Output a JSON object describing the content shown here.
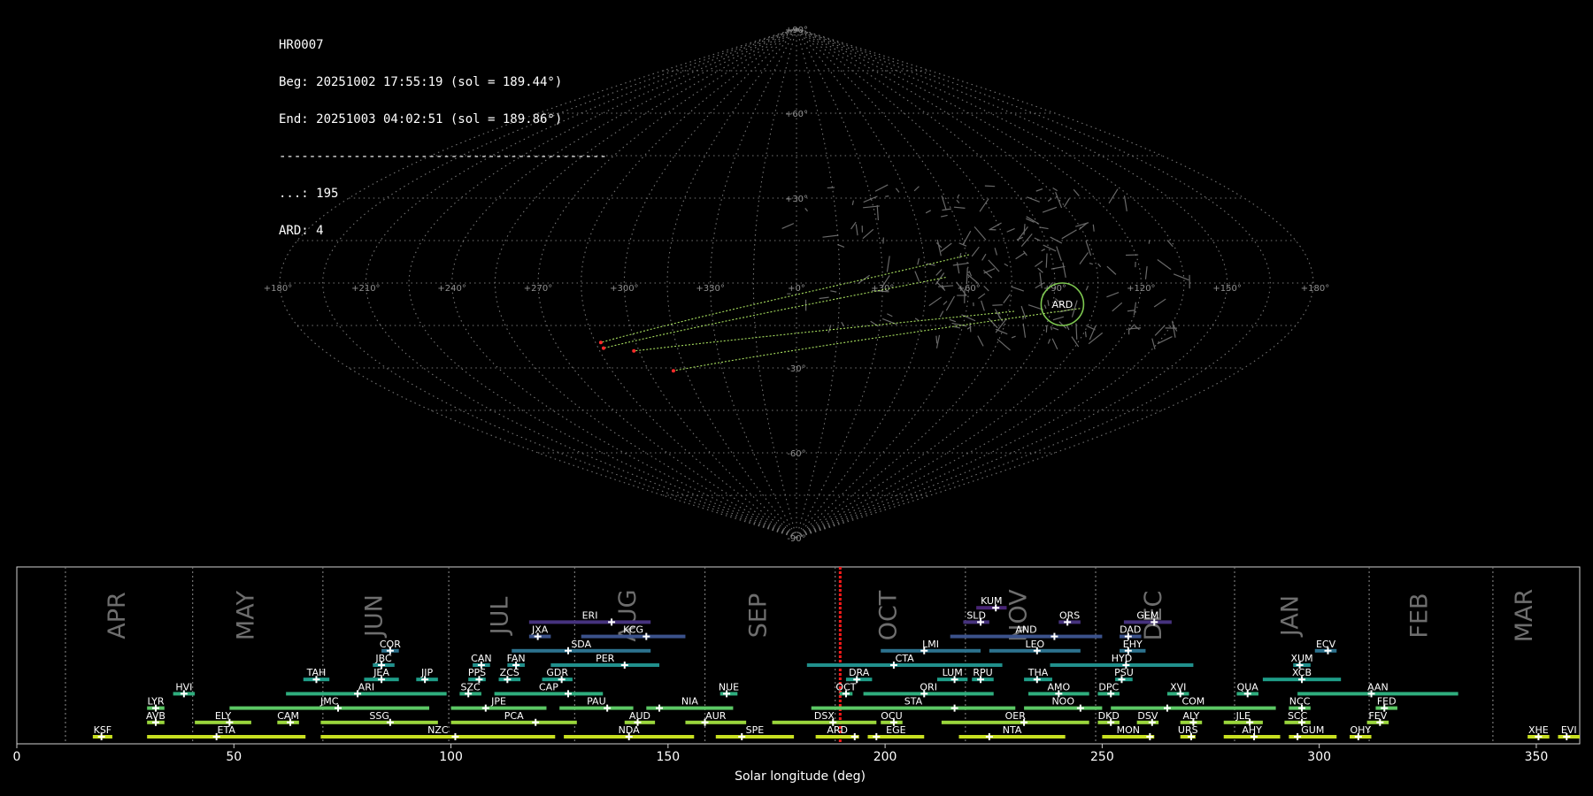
{
  "info": {
    "id": "HR0007",
    "beg": "Beg: 20251002 17:55:19 (sol = 189.44°)",
    "end": "End: 20251003 04:02:51 (sol = 189.86°)",
    "sep": "--------------------------------------------",
    "count_dots": "...: 195",
    "count_ard": "ARD: 4"
  },
  "sky_map": {
    "projection": "sinusoidal",
    "ra_labels": [
      "+180°",
      "+150°",
      "+120°",
      "+90°",
      "+60°",
      "+30°",
      "+0°",
      "+330°",
      "+300°",
      "+270°",
      "+240°",
      "+210°",
      "+180°"
    ],
    "dec_labels": [
      "+90°",
      "+60°",
      "+30°",
      "-30°",
      "-60°",
      "-90°"
    ],
    "grid_color": "#8a8a8a",
    "radiant": {
      "label": "ARD",
      "ra": 88,
      "dec": -5,
      "color": "#7ec850"
    },
    "meteor_color": "#a8e05f",
    "endpoint_color": "#ff2a2a",
    "meteors": [
      {
        "from": [
          77,
          -10
        ],
        "to": [
          -62,
          -24
        ]
      },
      {
        "from": [
          61,
          10
        ],
        "to": [
          -73,
          -21
        ]
      },
      {
        "from": [
          52,
          2
        ],
        "to": [
          -73,
          -23
        ]
      },
      {
        "from": [
          100,
          -9
        ],
        "to": [
          -50,
          -31
        ]
      }
    ]
  },
  "chart_data": {
    "type": "timeline",
    "xlabel": "Solar longitude (deg)",
    "xlim": [
      0,
      360
    ],
    "xticks": [
      0,
      50,
      100,
      150,
      200,
      250,
      300,
      350
    ],
    "current_sol": 189.65,
    "current_color": "#ff1a1a",
    "months": [
      {
        "name": "APR",
        "start": 11.2
      },
      {
        "name": "MAY",
        "start": 40.5
      },
      {
        "name": "JUN",
        "start": 70.5
      },
      {
        "name": "JUL",
        "start": 99.5
      },
      {
        "name": "AUG",
        "start": 128.5
      },
      {
        "name": "SEP",
        "start": 158.5
      },
      {
        "name": "OCT",
        "start": 188.5
      },
      {
        "name": "NOV",
        "start": 218.5
      },
      {
        "name": "DEC",
        "start": 248.5
      },
      {
        "name": "JAN",
        "start": 280.5
      },
      {
        "name": "FEB",
        "start": 311.5
      },
      {
        "name": "MAR",
        "start": 340
      }
    ],
    "showers": [
      {
        "code": "KSF",
        "start": 17.5,
        "end": 22,
        "peak": 19.5,
        "row": 0
      },
      {
        "code": "ETA",
        "start": 30,
        "end": 66.5,
        "peak": 46,
        "row": 0
      },
      {
        "code": "NZC",
        "start": 70,
        "end": 124,
        "peak": 101,
        "row": 0
      },
      {
        "code": "NDA",
        "start": 126,
        "end": 156,
        "peak": 141,
        "row": 0
      },
      {
        "code": "SPE",
        "start": 161,
        "end": 179,
        "peak": 167,
        "row": 0
      },
      {
        "code": "ARD",
        "start": 184,
        "end": 194,
        "peak": 193,
        "row": 0
      },
      {
        "code": "EGE",
        "start": 196,
        "end": 209,
        "peak": 198,
        "row": 0
      },
      {
        "code": "NTA",
        "start": 217,
        "end": 241.5,
        "peak": 224,
        "row": 0
      },
      {
        "code": "MON",
        "start": 250,
        "end": 262,
        "peak": 261,
        "row": 0
      },
      {
        "code": "URS",
        "start": 268,
        "end": 271.5,
        "peak": 270.5,
        "row": 0
      },
      {
        "code": "AHY",
        "start": 278,
        "end": 291,
        "peak": 285,
        "row": 0
      },
      {
        "code": "GUM",
        "start": 293,
        "end": 304,
        "peak": 295,
        "row": 0
      },
      {
        "code": "OHY",
        "start": 307,
        "end": 312,
        "peak": 309,
        "row": 0
      },
      {
        "code": "XHE",
        "start": 348,
        "end": 353,
        "peak": 350.5,
        "row": 0
      },
      {
        "code": "EVI",
        "start": 355,
        "end": 360,
        "peak": 357,
        "row": 0
      },
      {
        "code": "AVB",
        "start": 30,
        "end": 34,
        "peak": 32,
        "row": 1
      },
      {
        "code": "ELY",
        "start": 41,
        "end": 54,
        "peak": 49,
        "row": 1
      },
      {
        "code": "CAM",
        "start": 60,
        "end": 65,
        "peak": 63,
        "row": 1
      },
      {
        "code": "SSG",
        "start": 70,
        "end": 97,
        "peak": 86,
        "row": 1
      },
      {
        "code": "PCA",
        "start": 100,
        "end": 129,
        "peak": 119.5,
        "row": 1
      },
      {
        "code": "AUD",
        "start": 140,
        "end": 147,
        "peak": 143,
        "row": 1
      },
      {
        "code": "AUR",
        "start": 154,
        "end": 168,
        "peak": 158.5,
        "row": 1
      },
      {
        "code": "DSX",
        "start": 174,
        "end": 198,
        "peak": 188,
        "row": 1
      },
      {
        "code": "OCU",
        "start": 199,
        "end": 204,
        "peak": 202,
        "row": 1
      },
      {
        "code": "OER",
        "start": 213,
        "end": 247,
        "peak": 232,
        "row": 1
      },
      {
        "code": "DKD",
        "start": 249,
        "end": 254,
        "peak": 252,
        "row": 1
      },
      {
        "code": "DSV",
        "start": 258,
        "end": 263,
        "peak": 261.5,
        "row": 1
      },
      {
        "code": "ALY",
        "start": 268,
        "end": 273,
        "peak": 271,
        "row": 1
      },
      {
        "code": "JLE",
        "start": 278,
        "end": 287,
        "peak": 284,
        "row": 1
      },
      {
        "code": "SCC",
        "start": 292,
        "end": 298,
        "peak": 296,
        "row": 1
      },
      {
        "code": "FEV",
        "start": 311,
        "end": 316,
        "peak": 314,
        "row": 1
      },
      {
        "code": "LYR",
        "start": 30,
        "end": 34,
        "peak": 32,
        "row": 2
      },
      {
        "code": "JMC",
        "start": 49,
        "end": 95,
        "peak": 74,
        "row": 2
      },
      {
        "code": "JPE",
        "start": 100,
        "end": 122,
        "peak": 108,
        "row": 2
      },
      {
        "code": "PAU",
        "start": 125,
        "end": 142,
        "peak": 136,
        "row": 2
      },
      {
        "code": "NIA",
        "start": 145,
        "end": 165,
        "peak": 148,
        "row": 2
      },
      {
        "code": "STA",
        "start": 183,
        "end": 230,
        "peak": 216,
        "row": 2
      },
      {
        "code": "NOO",
        "start": 232,
        "end": 250,
        "peak": 245,
        "row": 2
      },
      {
        "code": "COM",
        "start": 252,
        "end": 290,
        "peak": 265,
        "row": 2
      },
      {
        "code": "NCC",
        "start": 293,
        "end": 298,
        "peak": 296,
        "row": 2
      },
      {
        "code": "FED",
        "start": 313,
        "end": 318,
        "peak": 315,
        "row": 2
      },
      {
        "code": "HVI",
        "start": 36,
        "end": 41,
        "peak": 38.5,
        "row": 3
      },
      {
        "code": "ARI",
        "start": 62,
        "end": 99,
        "peak": 78.5,
        "row": 3
      },
      {
        "code": "SZC",
        "start": 102,
        "end": 107,
        "peak": 104,
        "row": 3
      },
      {
        "code": "CAP",
        "start": 110,
        "end": 135,
        "peak": 127,
        "row": 3
      },
      {
        "code": "NUE",
        "start": 162,
        "end": 166,
        "peak": 163.5,
        "row": 3
      },
      {
        "code": "OCT",
        "start": 189.5,
        "end": 192.5,
        "peak": 191,
        "row": 3
      },
      {
        "code": "ORI",
        "start": 195,
        "end": 225,
        "peak": 209,
        "row": 3
      },
      {
        "code": "AMO",
        "start": 233,
        "end": 247,
        "peak": 240,
        "row": 3
      },
      {
        "code": "DPC",
        "start": 249,
        "end": 254,
        "peak": 252,
        "row": 3
      },
      {
        "code": "XVI",
        "start": 265,
        "end": 270,
        "peak": 268,
        "row": 3
      },
      {
        "code": "QUA",
        "start": 281,
        "end": 286,
        "peak": 283.5,
        "row": 3
      },
      {
        "code": "AAN",
        "start": 295,
        "end": 332,
        "peak": 312,
        "row": 3
      },
      {
        "code": "TAH",
        "start": 66,
        "end": 72,
        "peak": 69,
        "row": 4
      },
      {
        "code": "JEA",
        "start": 80,
        "end": 88,
        "peak": 84,
        "row": 4
      },
      {
        "code": "JIP",
        "start": 92,
        "end": 97,
        "peak": 94,
        "row": 4
      },
      {
        "code": "PPS",
        "start": 104,
        "end": 108,
        "peak": 106.5,
        "row": 4
      },
      {
        "code": "ZCS",
        "start": 111,
        "end": 116,
        "peak": 113,
        "row": 4
      },
      {
        "code": "GDR",
        "start": 121,
        "end": 128,
        "peak": 125.5,
        "row": 4
      },
      {
        "code": "DRA",
        "start": 191,
        "end": 197,
        "peak": 193.5,
        "row": 4
      },
      {
        "code": "LUM",
        "start": 212,
        "end": 219,
        "peak": 216,
        "row": 4
      },
      {
        "code": "RPU",
        "start": 220,
        "end": 225,
        "peak": 222,
        "row": 4
      },
      {
        "code": "THA",
        "start": 232,
        "end": 238.5,
        "peak": 235,
        "row": 4
      },
      {
        "code": "PSU",
        "start": 253,
        "end": 257,
        "peak": 254.5,
        "row": 4
      },
      {
        "code": "XCB",
        "start": 287,
        "end": 305,
        "peak": 296,
        "row": 4
      },
      {
        "code": "JBC",
        "start": 82,
        "end": 87,
        "peak": 84,
        "row": 5
      },
      {
        "code": "CAN",
        "start": 105,
        "end": 109,
        "peak": 107,
        "row": 5
      },
      {
        "code": "FAN",
        "start": 113,
        "end": 117,
        "peak": 115,
        "row": 5
      },
      {
        "code": "PER",
        "start": 123,
        "end": 148,
        "peak": 140,
        "row": 5
      },
      {
        "code": "CTA",
        "start": 182,
        "end": 227,
        "peak": 202,
        "row": 5
      },
      {
        "code": "HYD",
        "start": 238,
        "end": 271,
        "peak": 255.5,
        "row": 5
      },
      {
        "code": "XUM",
        "start": 294,
        "end": 298,
        "peak": 295.5,
        "row": 5
      },
      {
        "code": "COR",
        "start": 84,
        "end": 88,
        "peak": 86,
        "row": 6
      },
      {
        "code": "SDA",
        "start": 114,
        "end": 146,
        "peak": 127,
        "row": 6
      },
      {
        "code": "LMI",
        "start": 199,
        "end": 222,
        "peak": 209,
        "row": 6
      },
      {
        "code": "LEO",
        "start": 224,
        "end": 245,
        "peak": 235,
        "row": 6
      },
      {
        "code": "EHY",
        "start": 254,
        "end": 260,
        "peak": 256,
        "row": 6
      },
      {
        "code": "ECV",
        "start": 299,
        "end": 304,
        "peak": 302,
        "row": 6
      },
      {
        "code": "JXA",
        "start": 118,
        "end": 123,
        "peak": 120,
        "row": 7
      },
      {
        "code": "KCG",
        "start": 130,
        "end": 154,
        "peak": 145,
        "row": 7
      },
      {
        "code": "AND",
        "start": 215,
        "end": 250,
        "peak": 239,
        "row": 7
      },
      {
        "code": "DAD",
        "start": 254,
        "end": 259,
        "peak": 256,
        "row": 7
      },
      {
        "code": "ERI",
        "start": 118,
        "end": 146,
        "peak": 137,
        "row": 8
      },
      {
        "code": "SLD",
        "start": 218,
        "end": 224,
        "peak": 222,
        "row": 8
      },
      {
        "code": "ORS",
        "start": 240,
        "end": 245,
        "peak": 242,
        "row": 8
      },
      {
        "code": "GEM",
        "start": 255,
        "end": 266,
        "peak": 262,
        "row": 8
      },
      {
        "code": "KUM",
        "start": 221,
        "end": 228,
        "peak": 225.5,
        "row": 9
      }
    ],
    "row_colors": [
      "#c8e020",
      "#9ad63c",
      "#5cc764",
      "#2fae7e",
      "#1f9e89",
      "#21908c",
      "#2c728e",
      "#3b528b",
      "#46327e",
      "#482576"
    ]
  }
}
